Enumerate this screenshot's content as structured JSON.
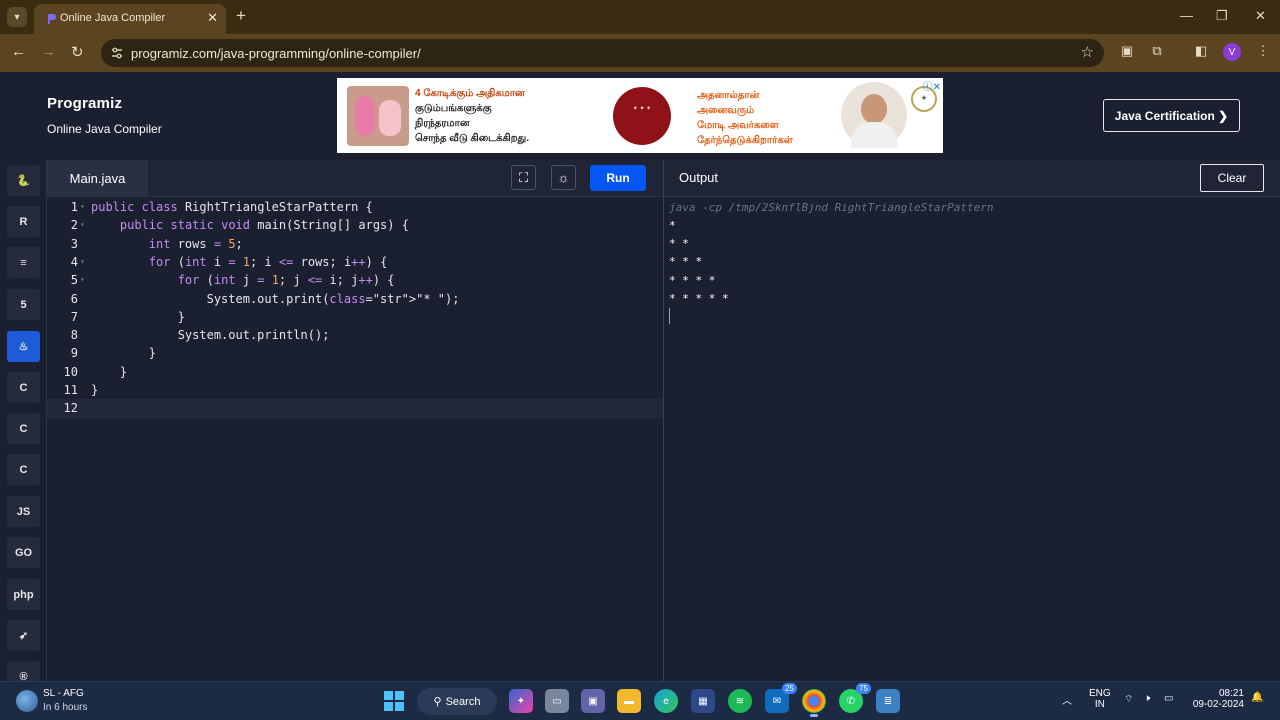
{
  "browser": {
    "tab_title": "Online Java Compiler",
    "url": "programiz.com/java-programming/online-compiler/",
    "profile_initial": "V"
  },
  "header": {
    "logo": "Programiz",
    "subtitle": "Online Java Compiler",
    "cert_button": "Java Certification ❯"
  },
  "ad": {
    "line1": "4 கோடிக்கும் அதிகமான",
    "line2": "குடும்பங்களுக்கு",
    "line3": "நிரந்தரமான",
    "line4": "சொந்த வீடு கிடைக்கிறது.",
    "right1": "அதனால்தான்",
    "right2": "அனைவரும்",
    "right3": "மோடி அவர்களை",
    "right4": "தேர்ந்தெடுக்கிறார்கள்"
  },
  "languages": [
    {
      "name": "python-icon",
      "glyph": "🐍"
    },
    {
      "name": "r-icon",
      "glyph": "R"
    },
    {
      "name": "sql-icon",
      "glyph": "≡"
    },
    {
      "name": "html-icon",
      "glyph": "5"
    },
    {
      "name": "java-icon",
      "glyph": "♨"
    },
    {
      "name": "c-icon",
      "glyph": "C"
    },
    {
      "name": "cpp-icon",
      "glyph": "C"
    },
    {
      "name": "csharp-icon",
      "glyph": "C"
    },
    {
      "name": "js-icon",
      "glyph": "JS"
    },
    {
      "name": "go-icon",
      "glyph": "GO"
    },
    {
      "name": "php-icon",
      "glyph": "php"
    },
    {
      "name": "swift-icon",
      "glyph": "➶"
    },
    {
      "name": "rust-icon",
      "glyph": "®"
    }
  ],
  "editor": {
    "file_name": "Main.java",
    "run_label": "Run",
    "lines": [
      "public class RightTriangleStarPattern {",
      "    public static void main(String[] args) {",
      "        int rows = 5;",
      "        for (int i = 1; i <= rows; i++) {",
      "            for (int j = 1; j <= i; j++) {",
      "                System.out.print(\"* \");",
      "            }",
      "            System.out.println();",
      "        }",
      "    }",
      "}",
      ""
    ]
  },
  "output": {
    "title": "Output",
    "clear_label": "Clear",
    "command": "java -cp /tmp/2SknflBjnd RightTriangleStarPattern",
    "lines": [
      "*",
      "* *",
      "* * *",
      "* * * *",
      "* * * * *"
    ]
  },
  "taskbar": {
    "weather_title": "SL - AFG",
    "weather_sub": "In 6 hours",
    "search_label": "Search",
    "badge_a": "25",
    "badge_b": "75",
    "lang_1": "ENG",
    "lang_2": "IN",
    "time": "08:21",
    "date": "09-02-2024"
  }
}
